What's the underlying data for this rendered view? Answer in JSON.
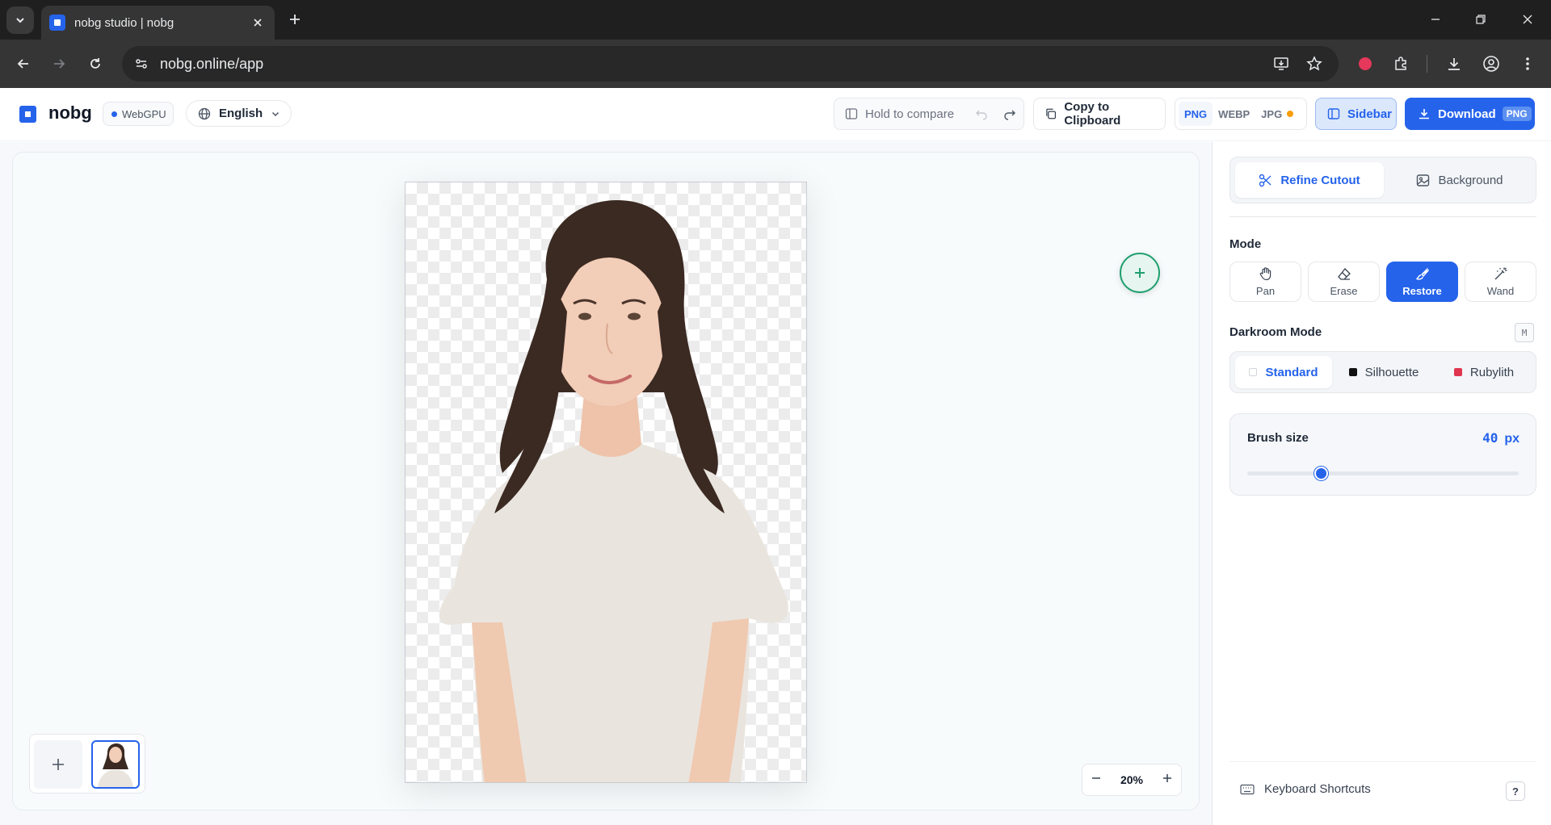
{
  "browser": {
    "tab_title": "nobg studio | nobg",
    "url": "nobg.online/app"
  },
  "header": {
    "logo_text": "nobg",
    "webgpu_badge": "WebGPU",
    "language": "English",
    "compare_label": "Hold to compare",
    "copy_label": "Copy to Clipboard",
    "formats": [
      "PNG",
      "WEBP",
      "JPG"
    ],
    "active_format": "PNG",
    "sidebar_label": "Sidebar",
    "download_label": "Download",
    "download_format": "PNG"
  },
  "canvas": {
    "zoom": "20%"
  },
  "sidebar": {
    "tabs": [
      {
        "label": "Refine Cutout",
        "icon": "scissors-icon"
      },
      {
        "label": "Background",
        "icon": "image-icon"
      }
    ],
    "mode_label": "Mode",
    "modes": [
      {
        "label": "Pan",
        "icon": "hand-icon"
      },
      {
        "label": "Erase",
        "icon": "eraser-icon"
      },
      {
        "label": "Restore",
        "icon": "brush-icon"
      },
      {
        "label": "Wand",
        "icon": "wand-icon"
      }
    ],
    "active_mode": "Restore",
    "darkroom_label": "Darkroom Mode",
    "darkroom_shortcut": "M",
    "darkroom_options": [
      {
        "label": "Standard",
        "color": "#ffffff"
      },
      {
        "label": "Silhouette",
        "color": "#111111"
      },
      {
        "label": "Rubylith",
        "color": "#e0344f"
      }
    ],
    "active_darkroom": "Standard",
    "brush_label": "Brush size",
    "brush_value": "40",
    "brush_unit": "px",
    "brush_fraction": 0.27,
    "shortcuts_label": "Keyboard Shortcuts",
    "help_label": "?"
  },
  "colors": {
    "accent": "#2563eb",
    "success": "#1e9f6f"
  }
}
